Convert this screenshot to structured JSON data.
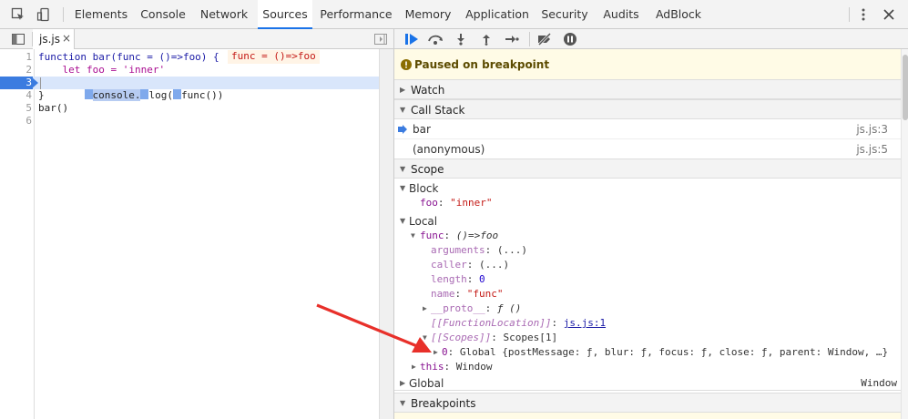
{
  "toolbar": {
    "tabs": [
      "Elements",
      "Console",
      "Network",
      "Sources",
      "Performance",
      "Memory",
      "Application",
      "Security",
      "Audits",
      "AdBlock"
    ],
    "active_tab": "Sources"
  },
  "source": {
    "file_tab": "js.js",
    "line_numbers": [
      "1",
      "2",
      "3",
      "4",
      "5",
      "6"
    ],
    "code": {
      "l1": "function bar(func = ()=>foo) {",
      "l1_inline": "func = ()=>foo",
      "l2": "    let foo = 'inner'",
      "l3a": "console.",
      "l3b": "log(",
      "l3c": "func())",
      "l4": "}",
      "l5": "bar()"
    }
  },
  "debugger": {
    "paused_text": "Paused on breakpoint",
    "sections": {
      "watch": "Watch",
      "call_stack": "Call Stack",
      "scope": "Scope",
      "breakpoints": "Breakpoints"
    },
    "call_stack": [
      {
        "name": "bar",
        "location": "js.js:3"
      },
      {
        "name": "(anonymous)",
        "location": "js.js:5"
      }
    ],
    "scope": {
      "block": "Block",
      "foo_key": "foo",
      "foo_val": "\"inner\"",
      "local": "Local",
      "func_key": "func",
      "func_val": "()=>foo",
      "arguments_key": "arguments",
      "arguments_val": "(...)",
      "caller_key": "caller",
      "caller_val": "(...)",
      "length_key": "length",
      "length_val": "0",
      "name_key": "name",
      "name_val": "\"func\"",
      "proto_key": "__proto__",
      "proto_val": "ƒ ()",
      "funcloc_key": "[[FunctionLocation]]",
      "funcloc_val": "js.js:1",
      "scopes_key": "[[Scopes]]",
      "scopes_val": "Scopes[1]",
      "global0_key": "0",
      "global0_label": "Global",
      "global0_val": "{postMessage: ƒ, blur: ƒ, focus: ƒ, close: ƒ, parent: Window, …}",
      "this_key": "this",
      "this_val": "Window",
      "global": "Global",
      "global_right": "Window"
    }
  },
  "colors": {
    "accent": "#1a73e8",
    "highlight_line": "#d9e6fb",
    "paused_bg": "#fffbe6",
    "arrow": "#e8302a"
  }
}
